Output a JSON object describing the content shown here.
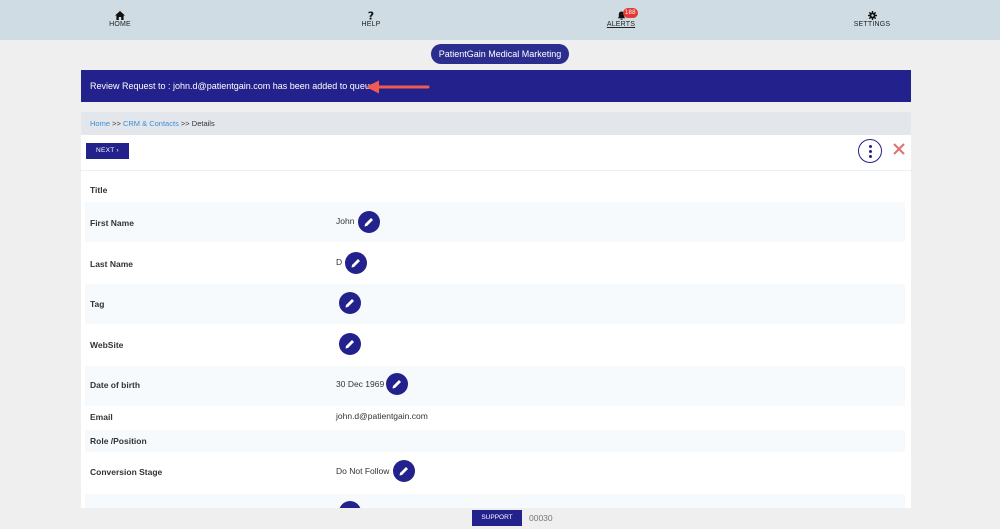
{
  "nav": {
    "home": "HOME",
    "help": "HELP",
    "alerts": "ALERTS",
    "alerts_badge": "188",
    "settings": "SETTINGS"
  },
  "brand": "PatientGain Medical Marketing",
  "toast": "Review Request to : john.d@patientgain.com has been added to queue.",
  "breadcrumb": {
    "home": "Home",
    "sep1": ">>",
    "crm": "CRM & Contacts",
    "sep2": ">>",
    "current": "Details"
  },
  "toolbar": {
    "next_label": "NEXT"
  },
  "fields": [
    {
      "label": "Title",
      "value": ""
    },
    {
      "label": "First Name",
      "value": "John"
    },
    {
      "label": "Last Name",
      "value": "D"
    },
    {
      "label": "Tag",
      "value": ""
    },
    {
      "label": "WebSite",
      "value": ""
    },
    {
      "label": "Date of birth",
      "value": "30 Dec 1969"
    },
    {
      "label": "Email",
      "value": "john.d@patientgain.com"
    },
    {
      "label": "Role /Position",
      "value": ""
    },
    {
      "label": "Conversion Stage",
      "value": "Do Not Follow"
    }
  ],
  "footer": {
    "support_label": "SUPPORT",
    "code": "00030"
  },
  "colors": {
    "primary": "#23228c",
    "nav_bg": "#cfdce4",
    "link": "#3a8fd8",
    "badge": "#e53935",
    "close": "#e07070",
    "arrow": "#f05a4f"
  }
}
